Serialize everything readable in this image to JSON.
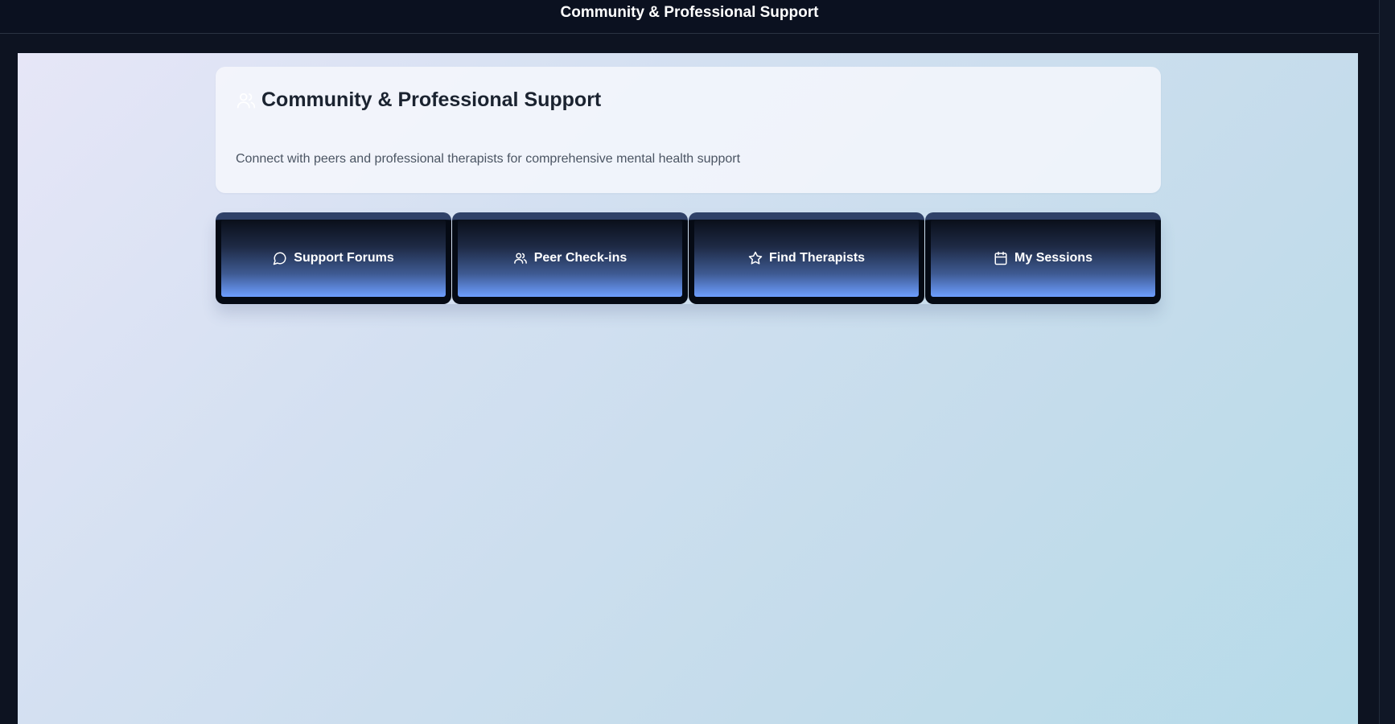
{
  "topbar": {
    "title": "Community & Professional Support"
  },
  "header": {
    "title": "Community & Professional Support",
    "description": "Connect with peers and professional therapists for comprehensive mental health support",
    "icon": "users-icon"
  },
  "tabs": [
    {
      "label": "Support Forums",
      "icon": "message-circle-icon"
    },
    {
      "label": "Peer Check-ins",
      "icon": "users-icon"
    },
    {
      "label": "Find Therapists",
      "icon": "star-icon"
    },
    {
      "label": "My Sessions",
      "icon": "calendar-icon"
    }
  ],
  "colors": {
    "topbar_bg": "#0b1120",
    "tab_gradient_bottom": "#6d9eff",
    "tab_border_top": "#2f4168",
    "title_text": "#1b2330"
  }
}
